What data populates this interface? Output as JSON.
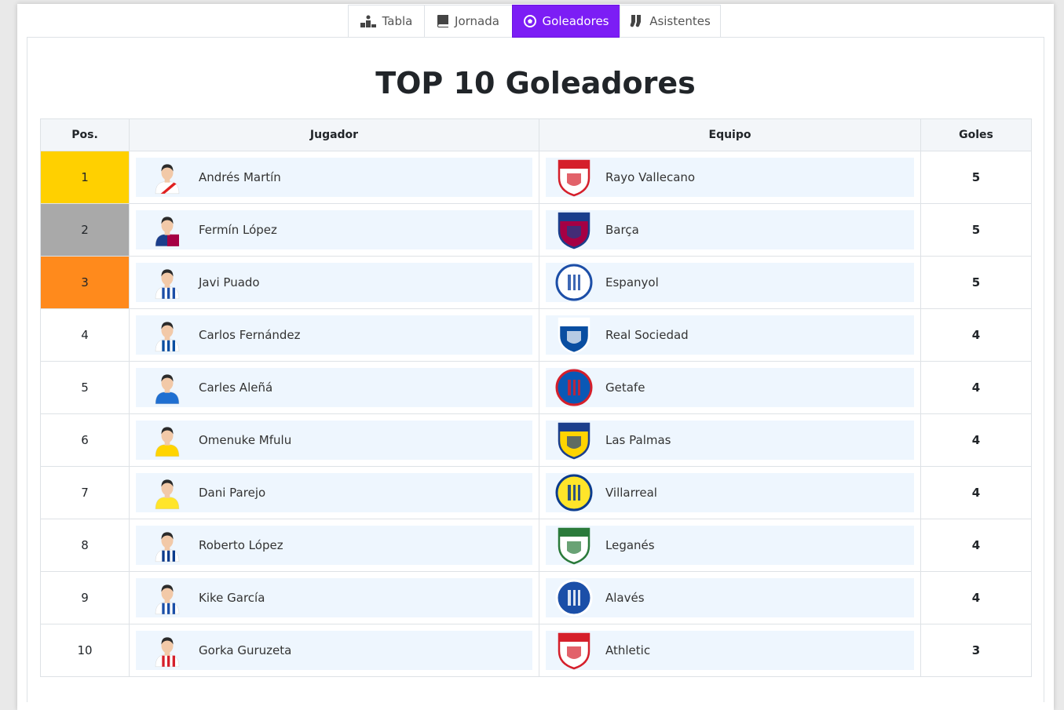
{
  "tabs": [
    {
      "label": "Tabla",
      "icon": "podium-icon"
    },
    {
      "label": "Jornada",
      "icon": "book-icon"
    },
    {
      "label": "Goleadores",
      "icon": "soccer-ball-icon",
      "active": true
    },
    {
      "label": "Asistentes",
      "icon": "socks-icon"
    }
  ],
  "title": "TOP 10 Goleadores",
  "headers": {
    "pos": "Pos.",
    "player": "Jugador",
    "team": "Equipo",
    "goals": "Goles"
  },
  "colors": {
    "accent": "#7c1df5",
    "gold": "#ffd000",
    "silver": "#a9a9a9",
    "bronze": "#ff8a1c",
    "chip": "#eef6fe"
  },
  "rows": [
    {
      "pos": "1",
      "player": "Andrés Martín",
      "team": "Rayo Vallecano",
      "goals": "5"
    },
    {
      "pos": "2",
      "player": "Fermín López",
      "team": "Barça",
      "goals": "5"
    },
    {
      "pos": "3",
      "player": "Javi Puado",
      "team": "Espanyol",
      "goals": "5"
    },
    {
      "pos": "4",
      "player": "Carlos Fernández",
      "team": "Real Sociedad",
      "goals": "4"
    },
    {
      "pos": "5",
      "player": "Carles Aleñá",
      "team": "Getafe",
      "goals": "4"
    },
    {
      "pos": "6",
      "player": "Omenuke Mfulu",
      "team": "Las Palmas",
      "goals": "4"
    },
    {
      "pos": "7",
      "player": "Dani Parejo",
      "team": "Villarreal",
      "goals": "4"
    },
    {
      "pos": "8",
      "player": "Roberto López",
      "team": "Leganés",
      "goals": "4"
    },
    {
      "pos": "9",
      "player": "Kike García",
      "team": "Alavés",
      "goals": "4"
    },
    {
      "pos": "10",
      "player": "Gorka Guruzeta",
      "team": "Athletic",
      "goals": "3"
    }
  ]
}
